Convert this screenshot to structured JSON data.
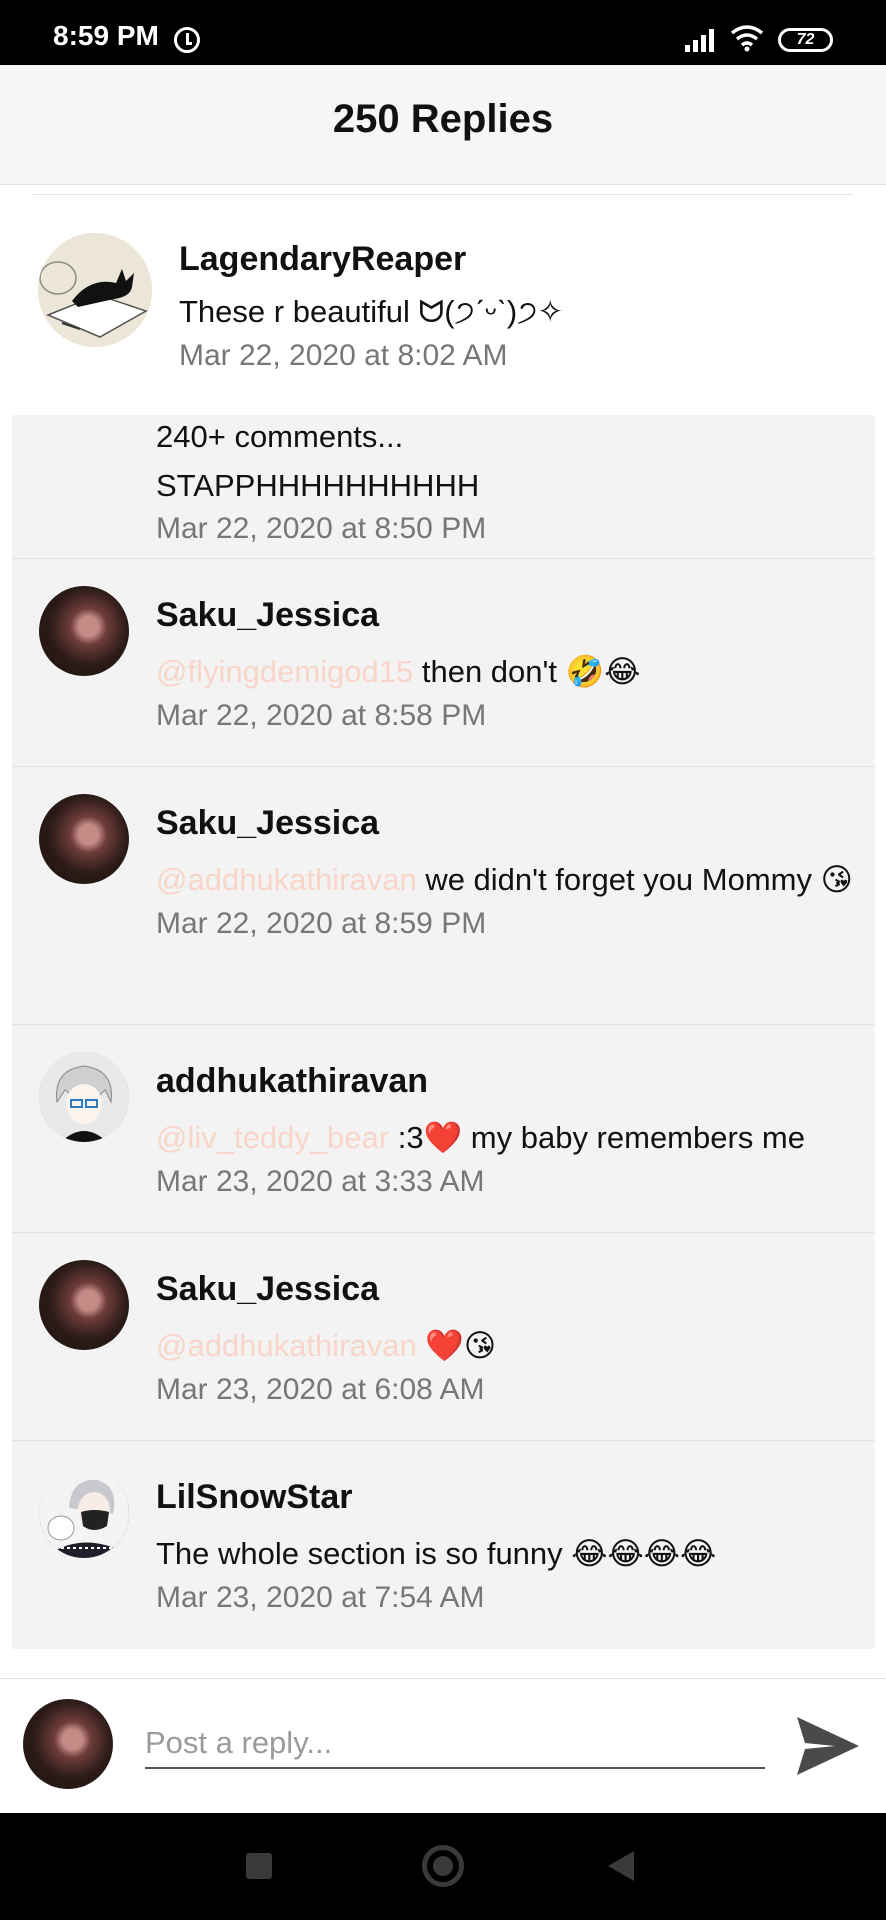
{
  "status_bar": {
    "time": "8:59 PM",
    "battery": "72",
    "icons": [
      "alarm-icon",
      "signal-icon",
      "wifi-icon",
      "battery-icon"
    ]
  },
  "header": {
    "title": "250 Replies"
  },
  "parent_comment": {
    "username": "LagendaryReaper",
    "text": "These r beautiful ᗢ(੭ˊᵕˋ)੭✧",
    "timestamp": "Mar 22, 2020 at 8:02 AM",
    "avatar": "black-cat-avatar"
  },
  "replies": [
    {
      "username": "",
      "mention": "",
      "text": "240+ comments...\nSTAPPHHHHHHHHHH",
      "timestamp": "Mar 22, 2020 at 8:50 PM",
      "avatar": ""
    },
    {
      "username": "Saku_Jessica",
      "mention": "@flyingdemigod15",
      "text": " then don't 🤣😂",
      "timestamp": "Mar 22, 2020 at 8:58 PM",
      "avatar": "rose-avatar"
    },
    {
      "username": "Saku_Jessica",
      "mention": "@addhukathiravan",
      "text": " we didn't forget you Mommy 😘",
      "timestamp": "Mar 22, 2020 at 8:59 PM",
      "avatar": "rose-avatar"
    },
    {
      "username": "addhukathiravan",
      "mention": "@liv_teddy_bear",
      "text": " :3❤️ my baby remembers me",
      "timestamp": "Mar 23, 2020 at 3:33 AM",
      "avatar": "anime-glasses-avatar"
    },
    {
      "username": "Saku_Jessica",
      "mention": "@addhukathiravan",
      "text": " ❤️😘",
      "timestamp": "Mar 23, 2020 at 6:08 AM",
      "avatar": "rose-avatar"
    },
    {
      "username": "LilSnowStar",
      "mention": "",
      "text": "The whole section is so funny 😂😂😂😂",
      "timestamp": "Mar 23, 2020 at 7:54 AM",
      "avatar": "snow-avatar"
    }
  ],
  "compose": {
    "placeholder": "Post a reply...",
    "value": "",
    "send_icon": "send-icon"
  },
  "nav_bar": {
    "icons": [
      "recents-icon",
      "home-icon",
      "back-icon"
    ]
  },
  "colors": {
    "mention": "#f8d5c8",
    "timestamp": "#777777",
    "reply_background": "#f3f3f3",
    "header_background": "#f6f6f6"
  }
}
